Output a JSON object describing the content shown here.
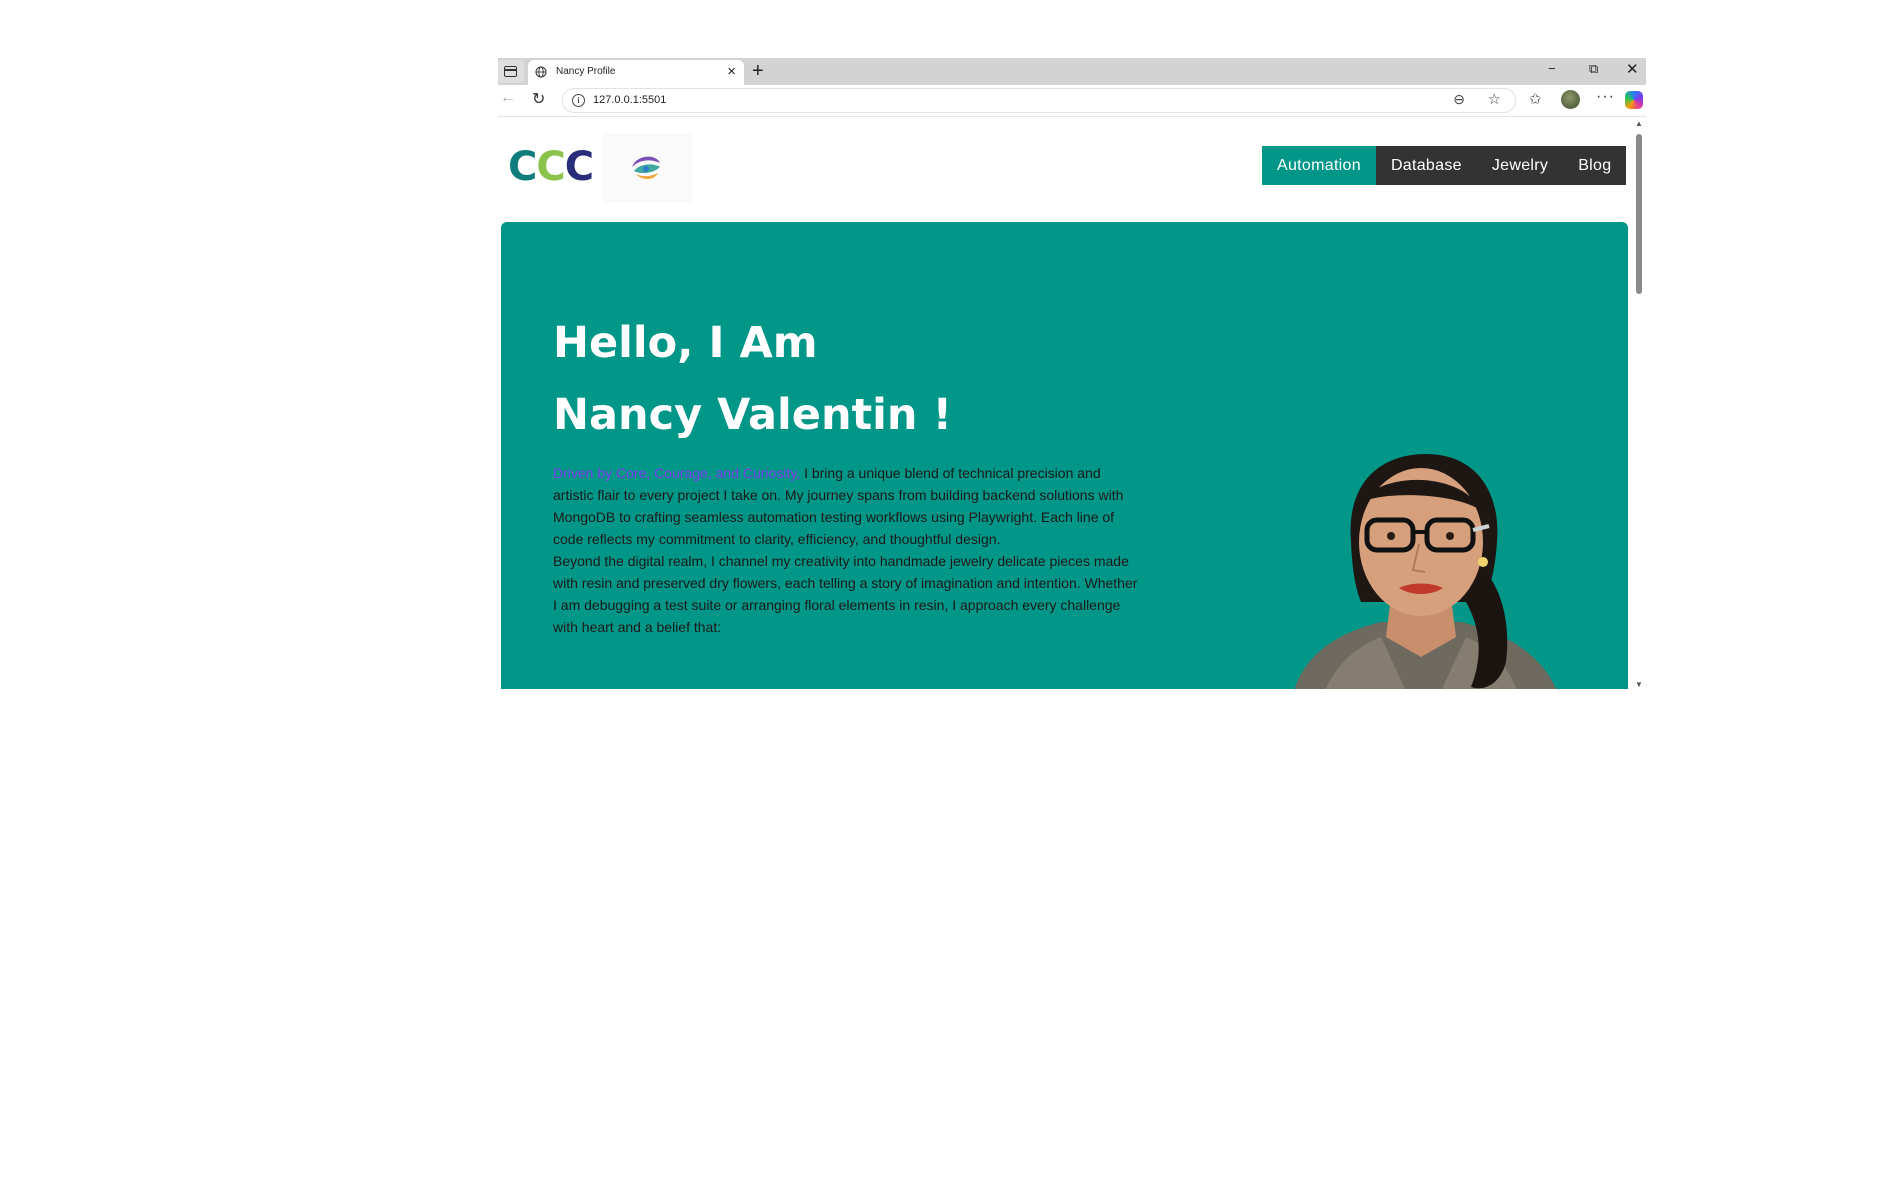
{
  "browser": {
    "tab_title": "Nancy Profile",
    "url": "127.0.0.1:5501",
    "new_tab_symbol": "+",
    "window_controls": {
      "minimize": "−",
      "restore": "⧉",
      "close": "✕"
    }
  },
  "site": {
    "logo_text": [
      "C",
      "C",
      "C"
    ],
    "nav": [
      {
        "label": "Automation",
        "active": true
      },
      {
        "label": "Database",
        "active": false
      },
      {
        "label": "Jewelry",
        "active": false
      },
      {
        "label": "Blog",
        "active": false
      }
    ],
    "hero": {
      "heading_line1": "Hello, I Am",
      "heading_line2": "Nancy Valentin !",
      "tagline": "Driven by Core, Courage, and Curiosity,",
      "para1_rest": " I bring a unique blend of technical precision and artistic flair to every project I take on. My journey spans from building backend solutions with MongoDB to crafting seamless automation testing workflows using Playwright. Each line of code reflects my commitment to clarity, efficiency, and thoughtful design.",
      "para2": "Beyond the digital realm, I channel my creativity into handmade jewelry delicate pieces made with resin and preserved dry flowers, each telling a story of imagination and intention. Whether I am debugging a test suite or arranging floral elements in resin, I approach every challenge with heart and a belief that:"
    }
  },
  "colors": {
    "teal": "#009688",
    "nav_dark": "#333333",
    "tagline_purple": "#7c3aed",
    "logo_teal": "#0f7d7e",
    "logo_green": "#8bc34a",
    "logo_navy": "#2a2d7a"
  },
  "icons": [
    "globe-icon",
    "close-icon",
    "back-arrow-icon",
    "reload-icon",
    "site-info-icon",
    "reading-mode-icon",
    "favorite-star-icon",
    "favorites-icon",
    "profile-avatar",
    "more-icon",
    "copilot-icon"
  ]
}
